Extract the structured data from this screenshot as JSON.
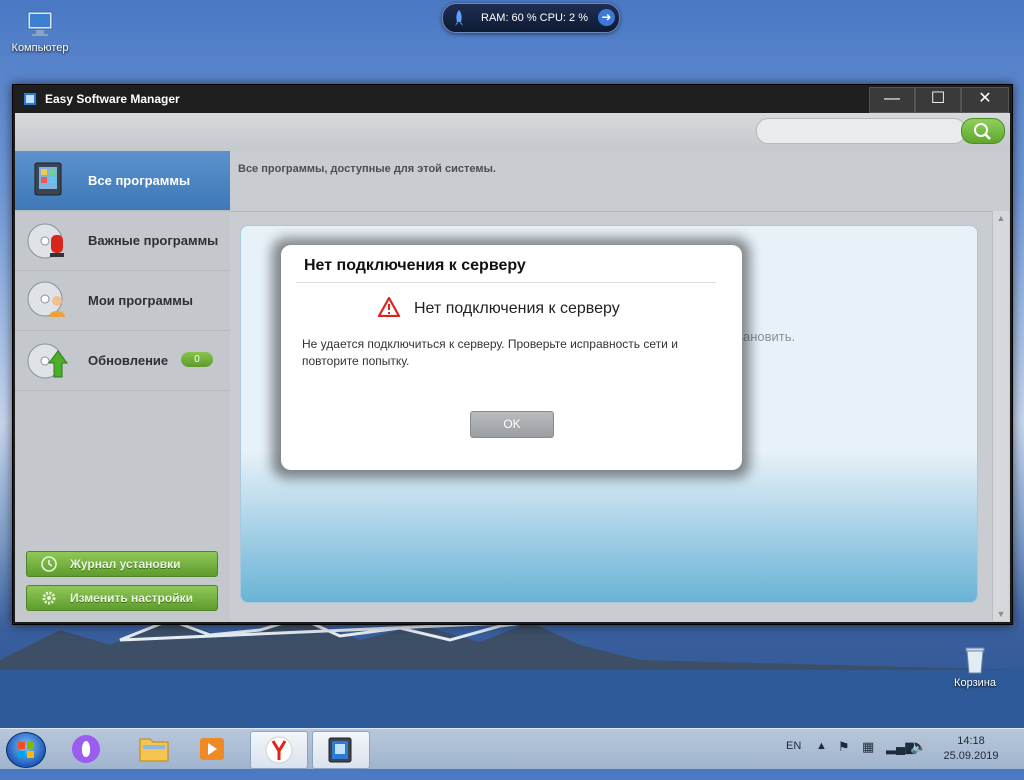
{
  "desktop": {
    "icons": [
      {
        "label": "Компьютер"
      },
      {
        "label": "Корзина"
      }
    ]
  },
  "gadget": {
    "text": "RAM: 60 % CPU: 2 %"
  },
  "window": {
    "title": "Easy Software Manager",
    "controls": {
      "minimize": "—",
      "maximize": "☐",
      "close": "✕"
    }
  },
  "sidebar": {
    "items": [
      {
        "label": "Все программы",
        "icon": "all-programs-icon",
        "active": true
      },
      {
        "label": "Важные программы",
        "icon": "important-programs-icon",
        "active": false
      },
      {
        "label": "Мои программы",
        "icon": "my-programs-icon",
        "active": false
      },
      {
        "label": "Обновление",
        "icon": "update-icon",
        "active": false,
        "badge": "0"
      }
    ],
    "buttons": [
      {
        "label": "Журнал установки",
        "icon": "clock-icon"
      },
      {
        "label": "Изменить настройки",
        "icon": "gear-icon"
      }
    ]
  },
  "main": {
    "hint": "Все программы, доступные для этой системы.",
    "background_text": "ановить."
  },
  "modal": {
    "title": "Нет подключения к серверу",
    "heading": "Нет подключения к серверу",
    "body": "Не удается подключиться к серверу. Проверьте исправность сети и повторите попытку.",
    "ok_label": "OK"
  },
  "taskbar": {
    "language": "EN",
    "time": "14:18",
    "date": "25.09.2019"
  },
  "colors": {
    "accent_green": "#6aaa36",
    "active_blue": "#4a84c2",
    "warning_red": "#d9261c"
  }
}
